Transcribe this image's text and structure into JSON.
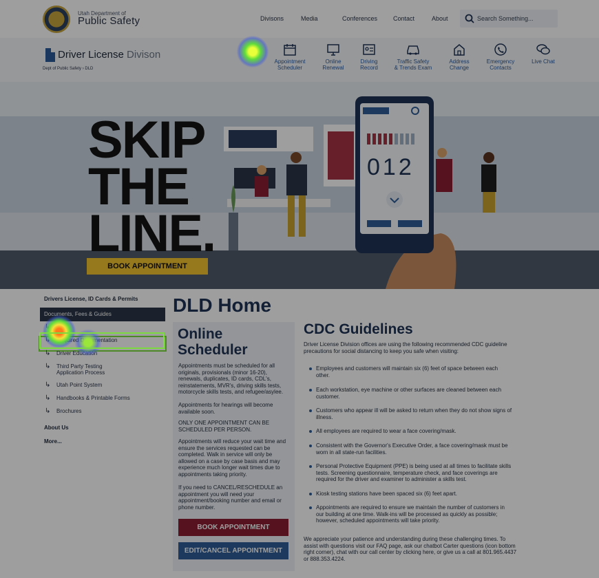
{
  "header": {
    "brand_small": "Utah Department of",
    "brand_big": "Public Safety",
    "nav": [
      "Divisons",
      "Media",
      "Conferences",
      "Contact",
      "About"
    ],
    "search_placeholder": "Search Something..."
  },
  "division": {
    "title_bold": "Driver License",
    "title_light": " Divison",
    "breadcrumb": [
      "Dept of Public Safety",
      "DLD"
    ],
    "quick_links": [
      {
        "label": "Appointment\nScheduler",
        "icon": "calendar-icon"
      },
      {
        "label": "Online\nRenewal",
        "icon": "monitor-icon"
      },
      {
        "label": "Driving\nRecord",
        "icon": "id-card-icon"
      },
      {
        "label": "Traffic Safety\n& Trends Exam",
        "icon": "car-icon"
      },
      {
        "label": "Address\nChange",
        "icon": "home-icon"
      },
      {
        "label": "Emergency\nContacts",
        "icon": "phone-icon"
      },
      {
        "label": "Live Chat",
        "icon": "chat-icon"
      }
    ]
  },
  "hero": {
    "headline_1": "SKIP",
    "headline_2": "THE",
    "headline_3": "LINE.",
    "counter": "012",
    "book_button": "BOOK APPOINTMENT"
  },
  "sidebar": {
    "section_1": "Drivers License, ID Cards & Permits",
    "active": "Documents, Fees & Guides",
    "subs": [
      "Fees",
      "Required Documentation",
      "Driver Education",
      "Third Party Testing\nApplication Process",
      "Utah Point System",
      "Handbooks & Printable Forms",
      "Brochures"
    ],
    "section_2": "About Us",
    "section_3": "More..."
  },
  "main": {
    "title": "DLD Home",
    "panel_title_1": "Online",
    "panel_title_2": "Scheduler",
    "p1": "Appointments must be scheduled for all originals, provisionals (minor 16-20), renewals, duplicates, ID cards, CDL's, reinstatements, MVR's, driving skills tests, motorcycle skills tests, and refugee/asylee.",
    "p2": "Appointments for hearings will become available soon.",
    "p3": "ONLY ONE APPOINTMENT CAN BE SCHEDULED PER PERSON.",
    "p4": "Appointments will reduce your wait time and ensure the services requested can be completed. Walk in service will only be allowed on a case by case basis and may experience much longer wait times due to appointments taking priority.",
    "p5": "If you need to CANCEL/RESCHEDULE an appointment you will need your appointment/booking number and email or phone number.",
    "book_button": "BOOK APPOINTMENT",
    "edit_button": "EDIT/CANCEL APPOINTMENT"
  },
  "cdc": {
    "title": "CDC Guidelines",
    "intro": "Driver License Division offices are using the following recommended CDC guideline precautions for social distancing to keep you safe when visiting:",
    "bullets": [
      "Employees and customers will maintain six (6) feet of space between each other.",
      "Each workstation, eye machine or other surfaces are cleaned between each customer.",
      "Customers who appear ill will be asked to return when they do not show signs of illness.",
      "All employees are required to wear a face covering/mask.",
      "Consistent with the Governor's Executive Order, a face covering/mask must be worn in all state-run facilities.",
      "Personal Protective Equipment (PPE) is being used at all times to facilitate skills tests. Screening questionnaire, temperature check, and face coverings are required for the driver and examiner to administer a skills test.",
      "Kiosk testing stations have been spaced six (6) feet apart.",
      "Appointments are required to ensure we maintain the number of customers in our building at one time. Walk-ins will be processed as quickly as possible; however, scheduled appointments will take priority."
    ],
    "closing": "We appreciate your patience and understanding during these challenging times. To assist with questions visit our FAQ page, ask our chatbot Carter questions (icon bottom right corner), chat with our call center by clicking here, or give us a call at 801.965.4437 or 888.353.4224."
  },
  "colors": {
    "navy": "#1e3354",
    "accent_yellow": "#f2c230",
    "burgundy": "#8b1f33",
    "blue_button": "#2f5d97",
    "heat_green": "#7cdc3f"
  }
}
